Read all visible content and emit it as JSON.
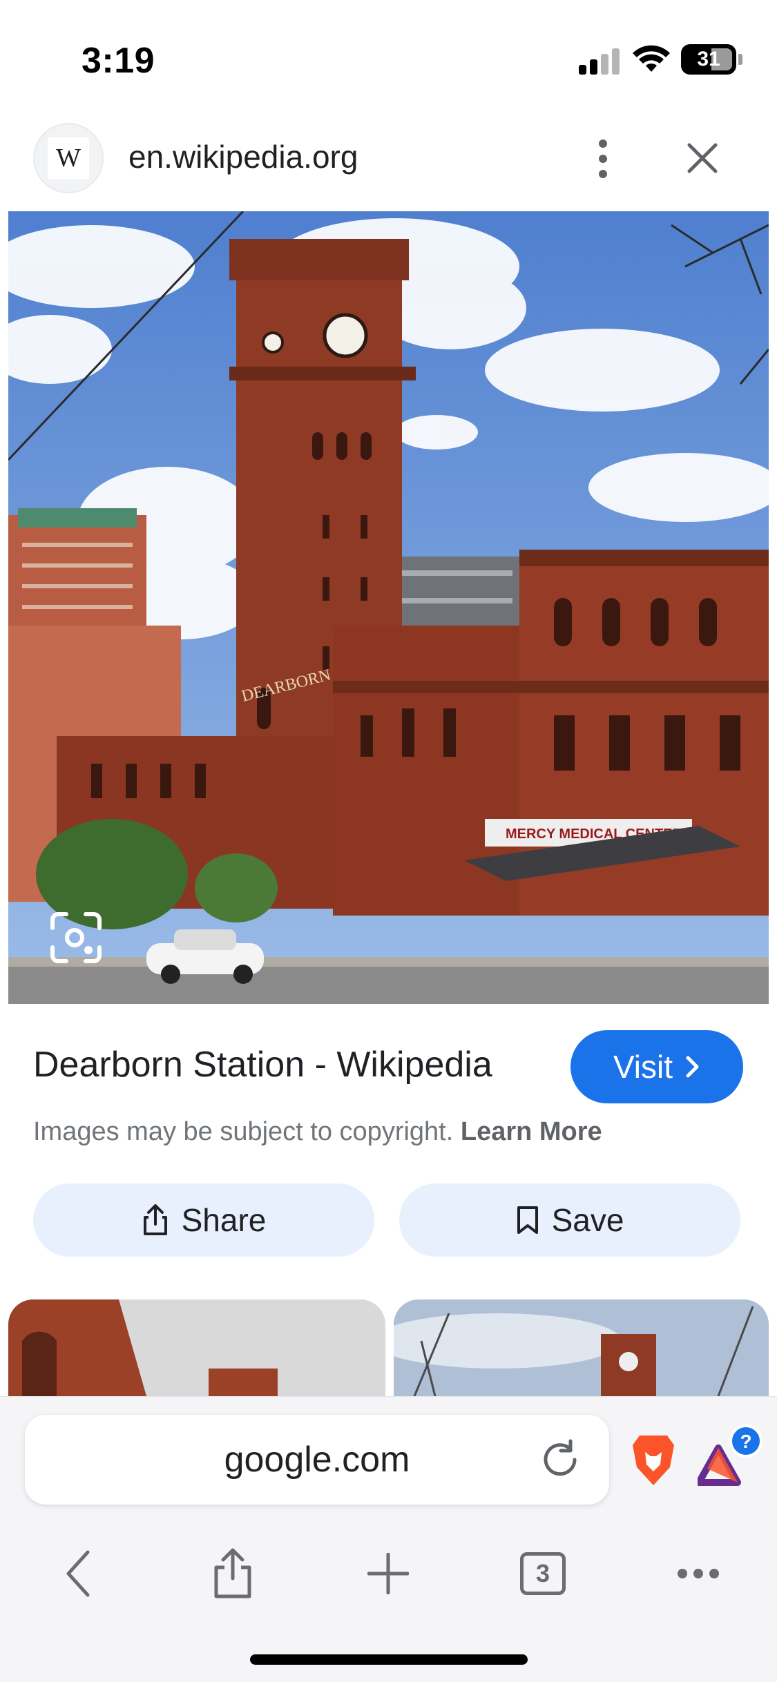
{
  "status_bar": {
    "time": "3:19",
    "battery_level": "31"
  },
  "site_header": {
    "favicon_letter": "W",
    "domain": "en.wikipedia.org"
  },
  "hero_image": {
    "alt": "Dearborn Station",
    "tower_sign": "DEARBORN STATION",
    "awning_sign": "MERCY MEDICAL CENTER"
  },
  "result": {
    "title": "Dearborn Station - Wikipedia",
    "visit_label": "Visit",
    "copyright_text": "Images may be subject to copyright.",
    "learn_more": "Learn More"
  },
  "actions": {
    "share_label": "Share",
    "save_label": "Save"
  },
  "bottom_bar": {
    "url": "google.com",
    "rewards_badge": "?",
    "tab_count": "3"
  },
  "colors": {
    "accent": "#1a73e8",
    "pill_bg": "#e8f0fe",
    "brave_orange": "#fb542b",
    "brick": "#8f3a24"
  }
}
